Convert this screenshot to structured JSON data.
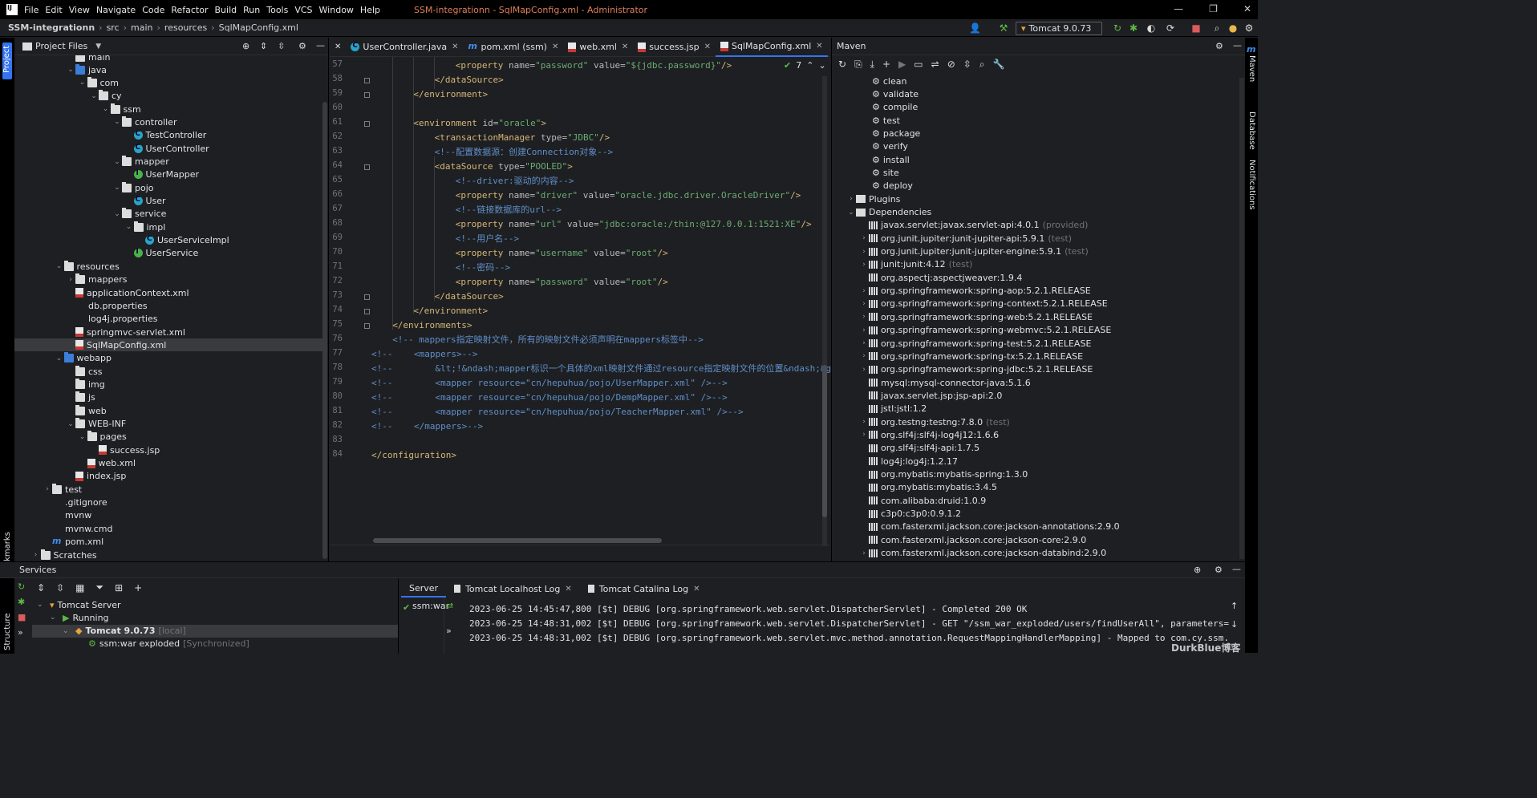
{
  "window": {
    "menus": [
      "File",
      "Edit",
      "View",
      "Navigate",
      "Code",
      "Refactor",
      "Build",
      "Run",
      "Tools",
      "VCS",
      "Window",
      "Help"
    ],
    "title": "SSM-integrationn - SqlMapConfig.xml - Administrator"
  },
  "breadcrumb": [
    "SSM-integrationn",
    "src",
    "main",
    "resources",
    "SqlMapConfig.xml"
  ],
  "run_config": "Tomcat 9.0.73",
  "project": {
    "title": "Project Files",
    "items": [
      {
        "label": "main",
        "depth": 4,
        "icon": "folder",
        "arrow": "",
        "y": -6
      },
      {
        "label": "java",
        "depth": 4,
        "icon": "folder-blue",
        "arrow": "v"
      },
      {
        "label": "com",
        "depth": 5,
        "icon": "folder",
        "arrow": "v"
      },
      {
        "label": "cy",
        "depth": 6,
        "icon": "folder",
        "arrow": "v"
      },
      {
        "label": "ssm",
        "depth": 7,
        "icon": "folder",
        "arrow": "v"
      },
      {
        "label": "controller",
        "depth": 8,
        "icon": "folder",
        "arrow": "v"
      },
      {
        "label": "TestController",
        "depth": 9,
        "icon": "cls",
        "arrow": ""
      },
      {
        "label": "UserController",
        "depth": 9,
        "icon": "cls",
        "arrow": ""
      },
      {
        "label": "mapper",
        "depth": 8,
        "icon": "folder",
        "arrow": "v"
      },
      {
        "label": "UserMapper",
        "depth": 9,
        "icon": "iface",
        "arrow": ""
      },
      {
        "label": "pojo",
        "depth": 8,
        "icon": "folder",
        "arrow": "v"
      },
      {
        "label": "User",
        "depth": 9,
        "icon": "cls",
        "arrow": ""
      },
      {
        "label": "service",
        "depth": 8,
        "icon": "folder",
        "arrow": "v"
      },
      {
        "label": "impl",
        "depth": 9,
        "icon": "folder",
        "arrow": "v"
      },
      {
        "label": "UserServiceImpl",
        "depth": 10,
        "icon": "cls",
        "arrow": ""
      },
      {
        "label": "UserService",
        "depth": 9,
        "icon": "iface",
        "arrow": ""
      },
      {
        "label": "resources",
        "depth": 3,
        "icon": "folder",
        "arrow": "v"
      },
      {
        "label": "mappers",
        "depth": 4,
        "icon": "folder",
        "arrow": ">"
      },
      {
        "label": "applicationContext.xml",
        "depth": 4,
        "icon": "xml",
        "arrow": ""
      },
      {
        "label": "db.properties",
        "depth": 4,
        "icon": "file",
        "arrow": ""
      },
      {
        "label": "log4j.properties",
        "depth": 4,
        "icon": "file",
        "arrow": ""
      },
      {
        "label": "springmvc-servlet.xml",
        "depth": 4,
        "icon": "xml",
        "arrow": ""
      },
      {
        "label": "SqlMapConfig.xml",
        "depth": 4,
        "icon": "xml",
        "arrow": "",
        "selected": true
      },
      {
        "label": "webapp",
        "depth": 3,
        "icon": "folder-blue",
        "arrow": "v"
      },
      {
        "label": "css",
        "depth": 4,
        "icon": "folder",
        "arrow": ""
      },
      {
        "label": "img",
        "depth": 4,
        "icon": "folder",
        "arrow": ""
      },
      {
        "label": "js",
        "depth": 4,
        "icon": "folder",
        "arrow": ""
      },
      {
        "label": "web",
        "depth": 4,
        "icon": "folder",
        "arrow": ""
      },
      {
        "label": "WEB-INF",
        "depth": 4,
        "icon": "folder",
        "arrow": "v"
      },
      {
        "label": "pages",
        "depth": 5,
        "icon": "folder",
        "arrow": "v"
      },
      {
        "label": "success.jsp",
        "depth": 6,
        "icon": "jsp",
        "arrow": ""
      },
      {
        "label": "web.xml",
        "depth": 5,
        "icon": "xml",
        "arrow": ""
      },
      {
        "label": "index.jsp",
        "depth": 4,
        "icon": "jsp",
        "arrow": ""
      },
      {
        "label": "test",
        "depth": 2,
        "icon": "folder",
        "arrow": ">"
      },
      {
        "label": ".gitignore",
        "depth": 2,
        "icon": "file",
        "arrow": ""
      },
      {
        "label": "mvnw",
        "depth": 2,
        "icon": "file",
        "arrow": ""
      },
      {
        "label": "mvnw.cmd",
        "depth": 2,
        "icon": "file",
        "arrow": ""
      },
      {
        "label": "pom.xml",
        "depth": 2,
        "icon": "m",
        "arrow": ""
      },
      {
        "label": "Scratches",
        "depth": 1,
        "icon": "folder",
        "arrow": ">"
      }
    ]
  },
  "tabs": [
    {
      "label": "UserController.java",
      "icon": "cls"
    },
    {
      "label": "pom.xml (ssm)",
      "icon": "m"
    },
    {
      "label": "web.xml",
      "icon": "xml"
    },
    {
      "label": "success.jsp",
      "icon": "jsp"
    },
    {
      "label": "SqlMapConfig.xml",
      "icon": "xml",
      "active": true
    }
  ],
  "editor": {
    "warnings": "7",
    "lines": [
      {
        "n": "57",
        "ind": 4,
        "parts": [
          [
            "tg",
            "<property "
          ],
          [
            "at",
            "name="
          ],
          [
            "st",
            "\"password\" "
          ],
          [
            "at",
            "value="
          ],
          [
            "st",
            "\"${jdbc.password}\""
          ],
          [
            "tg",
            "/>"
          ]
        ]
      },
      {
        "n": "58",
        "ind": 3,
        "parts": [
          [
            "tg",
            "</dataSource>"
          ]
        ]
      },
      {
        "n": "59",
        "ind": 2,
        "parts": [
          [
            "tg",
            "</environment>"
          ]
        ]
      },
      {
        "n": "60",
        "ind": 0,
        "parts": []
      },
      {
        "n": "61",
        "ind": 2,
        "parts": [
          [
            "tg",
            "<environment "
          ],
          [
            "at",
            "id="
          ],
          [
            "st",
            "\"oracle\""
          ],
          [
            "tg",
            ">"
          ]
        ]
      },
      {
        "n": "62",
        "ind": 3,
        "parts": [
          [
            "tg",
            "<transactionManager "
          ],
          [
            "at",
            "type="
          ],
          [
            "st",
            "\"JDBC\""
          ],
          [
            "tg",
            "/>"
          ]
        ]
      },
      {
        "n": "63",
        "ind": 3,
        "parts": [
          [
            "cm",
            "<!--配置数据源：创建Connection对象-->"
          ]
        ]
      },
      {
        "n": "64",
        "ind": 3,
        "parts": [
          [
            "tg",
            "<dataSource "
          ],
          [
            "at",
            "type="
          ],
          [
            "st",
            "\"POOLED\""
          ],
          [
            "tg",
            ">"
          ]
        ]
      },
      {
        "n": "65",
        "ind": 4,
        "parts": [
          [
            "cm",
            "<!--driver:驱动的内容-->"
          ]
        ]
      },
      {
        "n": "66",
        "ind": 4,
        "parts": [
          [
            "tg",
            "<property "
          ],
          [
            "at",
            "name="
          ],
          [
            "st",
            "\"driver\" "
          ],
          [
            "at",
            "value="
          ],
          [
            "st",
            "\"oracle.jdbc.driver.OracleDriver\""
          ],
          [
            "tg",
            "/>"
          ]
        ]
      },
      {
        "n": "67",
        "ind": 4,
        "parts": [
          [
            "cm",
            "<!--链接数据库的url-->"
          ]
        ]
      },
      {
        "n": "68",
        "ind": 4,
        "parts": [
          [
            "tg",
            "<property "
          ],
          [
            "at",
            "name="
          ],
          [
            "st",
            "\"url\" "
          ],
          [
            "at",
            "value="
          ],
          [
            "st",
            "\"jdbc:oracle:/thin:@127.0.0.1:1521:XE\""
          ],
          [
            "tg",
            "/>"
          ]
        ]
      },
      {
        "n": "69",
        "ind": 4,
        "parts": [
          [
            "cm",
            "<!--用户名-->"
          ]
        ]
      },
      {
        "n": "70",
        "ind": 4,
        "parts": [
          [
            "tg",
            "<property "
          ],
          [
            "at",
            "name="
          ],
          [
            "st",
            "\"username\" "
          ],
          [
            "at",
            "value="
          ],
          [
            "st",
            "\"root\""
          ],
          [
            "tg",
            "/>"
          ]
        ]
      },
      {
        "n": "71",
        "ind": 4,
        "parts": [
          [
            "cm",
            "<!--密码-->"
          ]
        ]
      },
      {
        "n": "72",
        "ind": 4,
        "parts": [
          [
            "tg",
            "<property "
          ],
          [
            "at",
            "name="
          ],
          [
            "st",
            "\"password\" "
          ],
          [
            "at",
            "value="
          ],
          [
            "st",
            "\"root\""
          ],
          [
            "tg",
            "/>"
          ]
        ]
      },
      {
        "n": "73",
        "ind": 3,
        "parts": [
          [
            "tg",
            "</dataSource>"
          ]
        ]
      },
      {
        "n": "74",
        "ind": 2,
        "parts": [
          [
            "tg",
            "</environment>"
          ]
        ]
      },
      {
        "n": "75",
        "ind": 1,
        "parts": [
          [
            "tg",
            "</environments>"
          ]
        ]
      },
      {
        "n": "76",
        "ind": 1,
        "parts": [
          [
            "cm",
            "<!-- mappers指定映射文件，所有的映射文件必须声明在mappers标签中-->"
          ]
        ]
      },
      {
        "n": "77",
        "ind": 0,
        "parts": [
          [
            "cm",
            "<!--    <mappers>-->"
          ]
        ]
      },
      {
        "n": "78",
        "ind": 0,
        "parts": [
          [
            "cm",
            "<!--        &lt;!&ndash;mapper标识一个具体的xml映射文件通过resource指定映射文件的位置&ndash;&g"
          ]
        ]
      },
      {
        "n": "79",
        "ind": 0,
        "parts": [
          [
            "cm",
            "<!--        <mapper resource=\"cn/hepuhua/pojo/UserMapper.xml\" />-->"
          ]
        ]
      },
      {
        "n": "80",
        "ind": 0,
        "parts": [
          [
            "cm",
            "<!--        <mapper resource=\"cn/hepuhua/pojo/DempMapper.xml\" />-->"
          ]
        ]
      },
      {
        "n": "81",
        "ind": 0,
        "parts": [
          [
            "cm",
            "<!--        <mapper resource=\"cn/hepuhua/pojo/TeacherMapper.xml\" />-->"
          ]
        ]
      },
      {
        "n": "82",
        "ind": 0,
        "parts": [
          [
            "cm",
            "<!--    </mappers>-->"
          ]
        ]
      },
      {
        "n": "83",
        "ind": 0,
        "parts": []
      },
      {
        "n": "84",
        "ind": 0,
        "parts": [
          [
            "tg",
            "</configuration>"
          ]
        ]
      }
    ]
  },
  "maven": {
    "title": "Maven",
    "lifecycle": [
      "clean",
      "validate",
      "compile",
      "test",
      "package",
      "verify",
      "install",
      "site",
      "deploy"
    ],
    "plugins": "Plugins",
    "dependencies": "Dependencies",
    "deps": [
      {
        "label": "javax.servlet:javax.servlet-api:4.0.1",
        "scope": "(provided)",
        "arrow": false
      },
      {
        "label": "org.junit.jupiter:junit-jupiter-api:5.9.1",
        "scope": "(test)",
        "arrow": true
      },
      {
        "label": "org.junit.jupiter:junit-jupiter-engine:5.9.1",
        "scope": "(test)",
        "arrow": true
      },
      {
        "label": "junit:junit:4.12",
        "scope": "(test)",
        "arrow": true
      },
      {
        "label": "org.aspectj:aspectjweaver:1.9.4",
        "scope": "",
        "arrow": false
      },
      {
        "label": "org.springframework:spring-aop:5.2.1.RELEASE",
        "scope": "",
        "arrow": true
      },
      {
        "label": "org.springframework:spring-context:5.2.1.RELEASE",
        "scope": "",
        "arrow": true
      },
      {
        "label": "org.springframework:spring-web:5.2.1.RELEASE",
        "scope": "",
        "arrow": true
      },
      {
        "label": "org.springframework:spring-webmvc:5.2.1.RELEASE",
        "scope": "",
        "arrow": true
      },
      {
        "label": "org.springframework:spring-test:5.2.1.RELEASE",
        "scope": "",
        "arrow": true
      },
      {
        "label": "org.springframework:spring-tx:5.2.1.RELEASE",
        "scope": "",
        "arrow": true
      },
      {
        "label": "org.springframework:spring-jdbc:5.2.1.RELEASE",
        "scope": "",
        "arrow": true
      },
      {
        "label": "mysql:mysql-connector-java:5.1.6",
        "scope": "",
        "arrow": false
      },
      {
        "label": "javax.servlet.jsp:jsp-api:2.0",
        "scope": "",
        "arrow": false
      },
      {
        "label": "jstl:jstl:1.2",
        "scope": "",
        "arrow": false
      },
      {
        "label": "org.testng:testng:7.8.0",
        "scope": "(test)",
        "arrow": true
      },
      {
        "label": "org.slf4j:slf4j-log4j12:1.6.6",
        "scope": "",
        "arrow": true
      },
      {
        "label": "org.slf4j:slf4j-api:1.7.5",
        "scope": "",
        "arrow": false
      },
      {
        "label": "log4j:log4j:1.2.17",
        "scope": "",
        "arrow": false
      },
      {
        "label": "org.mybatis:mybatis-spring:1.3.0",
        "scope": "",
        "arrow": false
      },
      {
        "label": "org.mybatis:mybatis:3.4.5",
        "scope": "",
        "arrow": false
      },
      {
        "label": "com.alibaba:druid:1.0.9",
        "scope": "",
        "arrow": false
      },
      {
        "label": "c3p0:c3p0:0.9.1.2",
        "scope": "",
        "arrow": false
      },
      {
        "label": "com.fasterxml.jackson.core:jackson-annotations:2.9.0",
        "scope": "",
        "arrow": false
      },
      {
        "label": "com.fasterxml.jackson.core:jackson-core:2.9.0",
        "scope": "",
        "arrow": false
      },
      {
        "label": "com.fasterxml.jackson.core:jackson-databind:2.9.0",
        "scope": "",
        "arrow": true
      }
    ]
  },
  "services": {
    "title": "Services",
    "tree": [
      {
        "label": "Tomcat Server",
        "depth": 0
      },
      {
        "label": "Running",
        "depth": 1
      },
      {
        "label": "Tomcat 9.0.73",
        "suffix": "[local]",
        "depth": 2
      },
      {
        "label": "ssm:war exploded",
        "suffix": "[Synchronized]",
        "depth": 3
      }
    ],
    "tabs": [
      "Server",
      "Tomcat Localhost Log",
      "Tomcat Catalina Log"
    ],
    "deploy_item": "ssm:war",
    "log": [
      "2023-06-25 14:45:47,800 [$t] DEBUG [org.springframework.web.servlet.DispatcherServlet] - Completed 200 OK",
      "2023-06-25 14:48:31,002 [$t] DEBUG [org.springframework.web.servlet.DispatcherServlet] - GET \"/ssm_war_exploded/users/findUserAll\", parameters={",
      "2023-06-25 14:48:31,002 [$t] DEBUG [org.springframework.web.servlet.mvc.method.annotation.RequestMappingHandlerMapping] - Mapped to com.cy.ssm."
    ],
    "watermark": "DurkBlue博客"
  },
  "side_labels": {
    "project": "Project",
    "bookmarks": "Bookmarks",
    "structure": "Structure",
    "maven": "Maven",
    "database": "Database",
    "notifications": "Notifications"
  }
}
